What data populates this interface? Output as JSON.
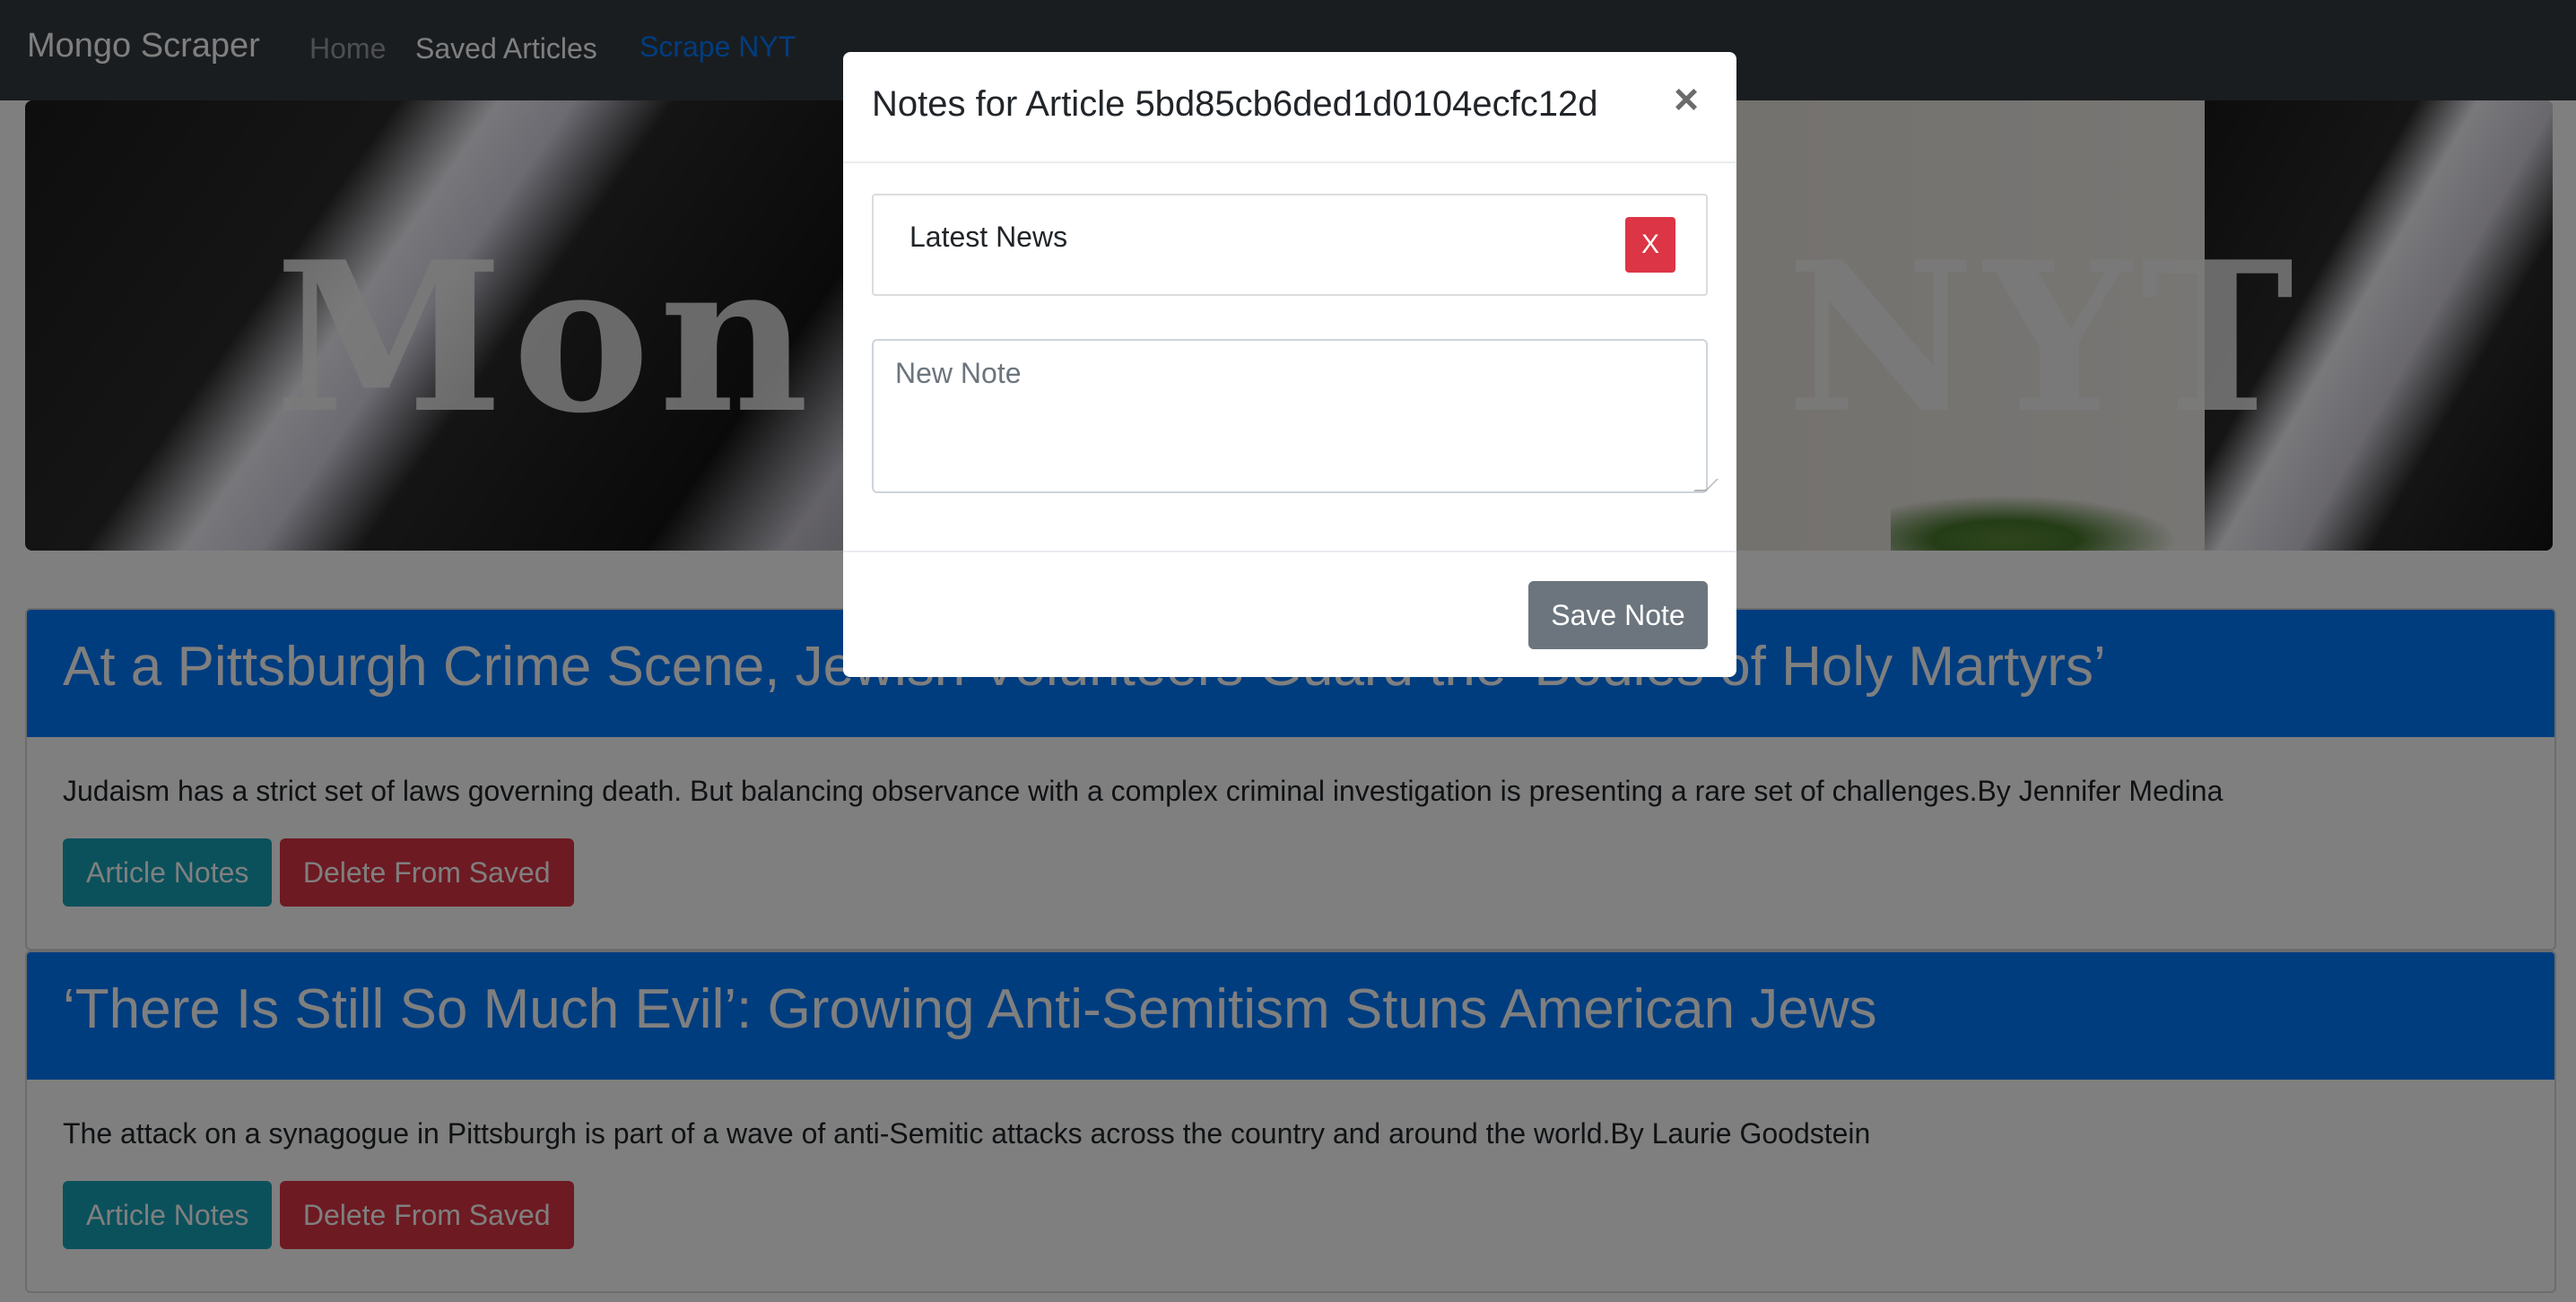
{
  "navbar": {
    "brand": "Mongo Scraper",
    "links": [
      {
        "label": "Home"
      },
      {
        "label": "Saved Articles"
      },
      {
        "label": "Scrape NYT"
      }
    ]
  },
  "hero": {
    "title_visible_left": "Mon",
    "title_visible_right": "NYT"
  },
  "articles": [
    {
      "title": "At a Pittsburgh Crime Scene, Jewish Volunteers Guard the ‘Bodies of Holy Martyrs’",
      "summary": "Judaism has a strict set of laws governing death. But balancing observance with a complex criminal investigation is presenting a rare set of challenges.By Jennifer Medina",
      "notes_button": "Article Notes",
      "delete_button": "Delete From Saved"
    },
    {
      "title": "‘There Is Still So Much Evil’: Growing Anti-Semitism Stuns American Jews",
      "summary": "The attack on a synagogue in Pittsburgh is part of a wave of anti-Semitic attacks across the country and around the world.By Laurie Goodstein",
      "notes_button": "Article Notes",
      "delete_button": "Delete From Saved"
    }
  ],
  "modal": {
    "title": "Notes for Article 5bd85cb6ded1d0104ecfc12d",
    "close_glyph": "×",
    "notes": [
      {
        "text": "Latest News",
        "delete_label": "X"
      }
    ],
    "new_note_placeholder": "New Note",
    "save_button": "Save Note"
  },
  "colors": {
    "navbar_bg": "#343a40",
    "primary": "#007bff",
    "info": "#17a2b8",
    "danger": "#dc3545",
    "secondary": "#6c757d"
  },
  "icons": {
    "close": "close-icon",
    "resize": "resize-grip-icon"
  }
}
